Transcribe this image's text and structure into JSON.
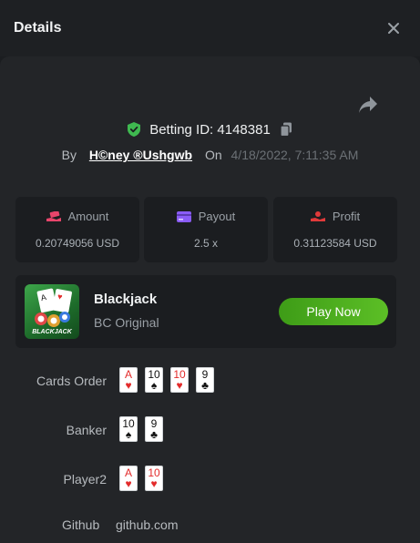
{
  "header": {
    "title": "Details",
    "close_icon": "close-icon"
  },
  "bet": {
    "id_label": "Betting ID:",
    "id_value": "4148381",
    "by_label": "By",
    "user": "H©ney ®Ushgwb",
    "on_label": "On",
    "date": "4/18/2022, 7:11:35 AM"
  },
  "stats": [
    {
      "label": "Amount",
      "value": "0.20749056 USD",
      "icon": "money-hand-icon",
      "color": "#e8456b"
    },
    {
      "label": "Payout",
      "value": "2.5 x",
      "icon": "card-icon",
      "color": "#8a5cf6"
    },
    {
      "label": "Profit",
      "value": "0.31123584 USD",
      "icon": "hand-coins-icon",
      "color": "#e03a3a"
    }
  ],
  "game": {
    "name": "Blackjack",
    "subtitle": "BC Original",
    "thumb_text": "BLACKJACK",
    "play_label": "Play Now",
    "play_color": "#45a81c"
  },
  "hands": {
    "cards_order_label": "Cards Order",
    "banker_label": "Banker",
    "player2_label": "Player2",
    "cards_order": [
      {
        "rank": "A",
        "suit": "♥"
      },
      {
        "rank": "10",
        "suit": "♠"
      },
      {
        "rank": "10",
        "suit": "♥"
      },
      {
        "rank": "9",
        "suit": "♣"
      }
    ],
    "banker": [
      {
        "rank": "10",
        "suit": "♠"
      },
      {
        "rank": "9",
        "suit": "♣"
      }
    ],
    "player2": [
      {
        "rank": "A",
        "suit": "♥"
      },
      {
        "rank": "10",
        "suit": "♥"
      }
    ]
  },
  "github": {
    "label": "Github",
    "value": "github.com"
  },
  "colors": {
    "accent_green": "#45a81c",
    "verified_green": "#3fb950",
    "panel": "#232528",
    "background": "#1b1d20"
  }
}
